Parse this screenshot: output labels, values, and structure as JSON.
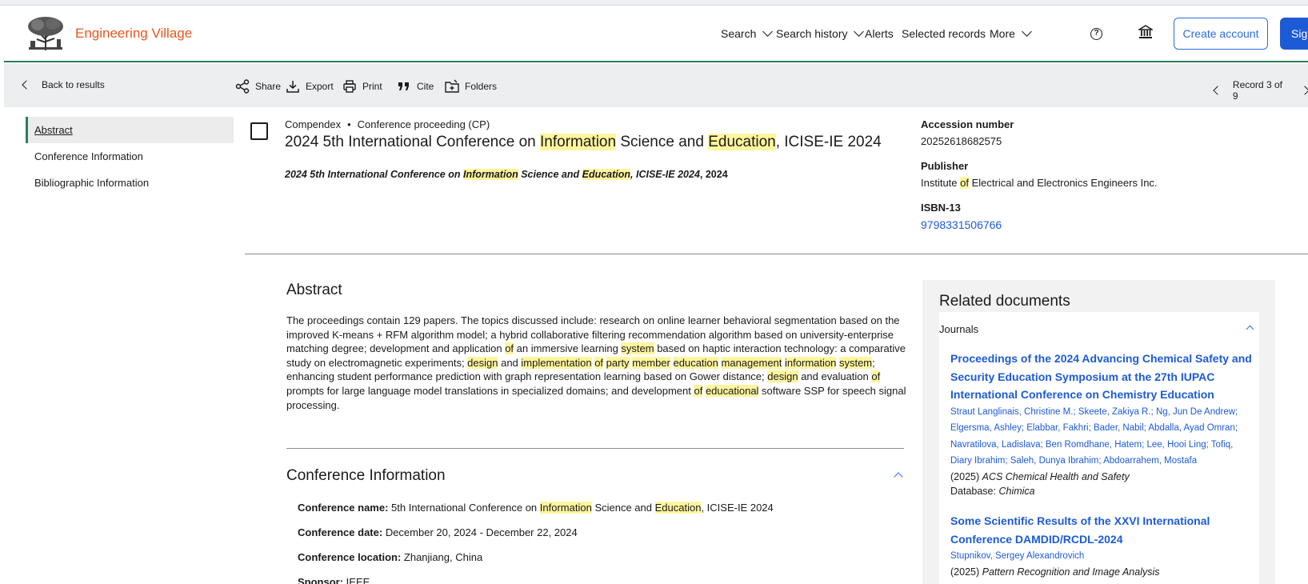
{
  "header": {
    "brand": "Engineering Village",
    "nav": [
      "Search",
      "Search history",
      "Alerts",
      "Selected records",
      "More"
    ],
    "help": "?",
    "create_account": "Create account",
    "sign_in": "Sign"
  },
  "toolbar": {
    "back": "Back to results",
    "share": "Share",
    "export": "Export",
    "print": "Print",
    "cite": "Cite",
    "folders": "Folders",
    "record_position": "Record 3 of 9"
  },
  "leftnav": [
    "Abstract",
    "Conference Information",
    "Bibliographic Information"
  ],
  "record": {
    "database": "Compendex",
    "doc_type": "Conference proceeding (CP)",
    "title_parts": [
      "2024 5th International Conference on ",
      "Information",
      " Science and ",
      "Education",
      ", ICISE-IE 2024"
    ],
    "subtitle_parts": [
      "2024 5th International Conference on ",
      "Information",
      " Science and ",
      "Education",
      ", ICISE-IE 2024",
      ", 2024"
    ]
  },
  "details": {
    "accession_label": "Accession number",
    "accession_value": "20252618682575",
    "publisher_label": "Publisher",
    "publisher_parts": [
      "Institute ",
      "of",
      " Electrical and Electronics Engineers Inc."
    ],
    "isbn_label": "ISBN-13",
    "isbn_value": "9798331506766"
  },
  "abstract": {
    "heading": "Abstract",
    "parts": [
      [
        "The proceedings contain 129 papers. The topics discussed include: research on online learner behavioral segmentation based on the improved K-means + RFM algorithm model; a hybrid collaborative filtering recommendation algorithm based on university-enterprise matching degree; development and application ",
        false
      ],
      [
        "of",
        true
      ],
      [
        " an immersive learning ",
        false
      ],
      [
        "system",
        true
      ],
      [
        " based on haptic interaction technology: a comparative study on electromagnetic experiments; ",
        false
      ],
      [
        "design",
        true
      ],
      [
        " and ",
        false
      ],
      [
        "implementation",
        true
      ],
      [
        " ",
        false
      ],
      [
        "of",
        true
      ],
      [
        " ",
        false
      ],
      [
        "party",
        true
      ],
      [
        " ",
        false
      ],
      [
        "member",
        true
      ],
      [
        " ",
        false
      ],
      [
        "education",
        true
      ],
      [
        " ",
        false
      ],
      [
        "management",
        true
      ],
      [
        " ",
        false
      ],
      [
        "information",
        true
      ],
      [
        " ",
        false
      ],
      [
        "system",
        true
      ],
      [
        "; enhancing student performance prediction with graph representation learning based on Gower distance; ",
        false
      ],
      [
        "design",
        true
      ],
      [
        " and evaluation ",
        false
      ],
      [
        "of",
        true
      ],
      [
        " prompts for large language model translations in specialized domains; and development ",
        false
      ],
      [
        "of",
        true
      ],
      [
        " ",
        false
      ],
      [
        "educational",
        true
      ],
      [
        " software SSP for speech signal processing.",
        false
      ]
    ]
  },
  "conference": {
    "heading": "Conference Information",
    "name_label": "Conference name:",
    "name_parts": [
      " 5th International Conference on ",
      "Information",
      " Science and ",
      "Education",
      ", ICISE-IE 2024"
    ],
    "date_label": "Conference date:",
    "date_value": " December 20, 2024 - December 22, 2024",
    "location_label": "Conference location:",
    "location_value": " Zhanjiang, China",
    "sponsor_label": "Sponsor:",
    "sponsor_value": " IEEE"
  },
  "related": {
    "heading": "Related documents",
    "section": "Journals",
    "docs": [
      {
        "title": "Proceedings of the 2024 Advancing Chemical Safety and Security Education Symposium at the 27th IUPAC International Conference on Chemistry Education",
        "authors": "Straut Langlinais, Christine M.; Skeete, Zakiya R.; Ng, Jun De Andrew; Elgersma, Ashley; Elabbar, Fakhri; Bader, Nabil; Abdalla, Ayad Omran; Navratilova, Ladislava; Ben Romdhane, Hatem; Lee, Hooi Ling; Tofiq, Diary Ibrahim; Saleh, Dunya Ibrahim; Abdoarrahem, Mostafa",
        "year": "(2025) ",
        "journal": "ACS Chemical Health and Safety",
        "db_label": "Database: ",
        "db": "Chimica"
      },
      {
        "title": "Some Scientific Results of the XXVI International Conference DAMDID/RCDL-2024",
        "authors": "Stupnikov, Sergey Alexandrovich",
        "year": "(2025) ",
        "journal": "Pattern Recognition and Image Analysis"
      }
    ]
  }
}
